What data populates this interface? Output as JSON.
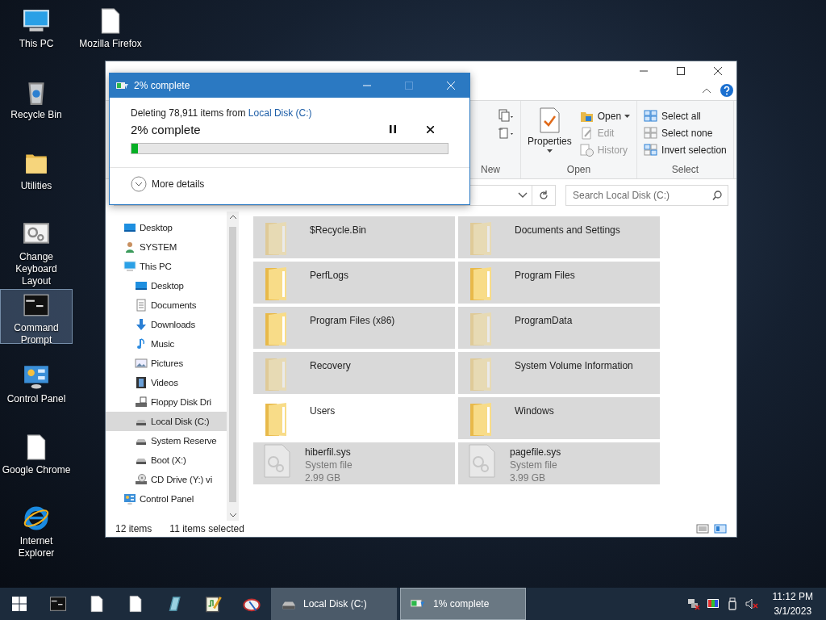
{
  "desktop": {
    "columns": [
      [
        {
          "label": "This PC",
          "kind": "pc",
          "selected": false
        },
        {
          "label": "Recycle Bin",
          "kind": "recycle",
          "selected": false
        },
        {
          "label": "Utilities",
          "kind": "folder",
          "selected": false
        },
        {
          "label": "Change Keyboard Layout",
          "kind": "settings",
          "selected": false
        },
        {
          "label": "Command Prompt",
          "kind": "console",
          "selected": true
        },
        {
          "label": "Control Panel",
          "kind": "control-panel",
          "selected": false
        },
        {
          "label": "Google Chrome",
          "kind": "document",
          "selected": false
        },
        {
          "label": "Internet Explorer",
          "kind": "browser",
          "selected": false
        }
      ],
      [
        {
          "label": "Mozilla Firefox",
          "kind": "document",
          "selected": false
        }
      ]
    ]
  },
  "explorer": {
    "ribbon": {
      "groups": [
        {
          "label": "New",
          "items": [
            {
              "kind": "small-icons"
            }
          ]
        },
        {
          "label": "Open",
          "items": [
            {
              "kind": "big",
              "label": "Properties"
            },
            {
              "kind": "small",
              "label": "Open",
              "caret": true,
              "disabled": false
            },
            {
              "kind": "small",
              "label": "Edit",
              "disabled": true
            },
            {
              "kind": "small",
              "label": "History",
              "disabled": true
            }
          ]
        },
        {
          "label": "Select",
          "items": [
            {
              "kind": "small",
              "label": "Select all",
              "disabled": false
            },
            {
              "kind": "small",
              "label": "Select none",
              "disabled": false
            },
            {
              "kind": "small",
              "label": "Invert selection",
              "disabled": false
            }
          ]
        }
      ]
    },
    "search": {
      "placeholder": "Search Local Disk (C:)"
    },
    "nav": [
      {
        "label": "Desktop",
        "kind": "desktop",
        "selected": false
      },
      {
        "label": "SYSTEM",
        "kind": "user",
        "selected": false
      },
      {
        "label": "This PC",
        "kind": "pc",
        "selected": false,
        "children": [
          {
            "label": "Desktop",
            "kind": "desktop",
            "selected": false
          },
          {
            "label": "Documents",
            "kind": "documents",
            "selected": false
          },
          {
            "label": "Downloads",
            "kind": "downloads",
            "selected": false
          },
          {
            "label": "Music",
            "kind": "music",
            "selected": false
          },
          {
            "label": "Pictures",
            "kind": "pictures",
            "selected": false
          },
          {
            "label": "Videos",
            "kind": "videos",
            "selected": false
          },
          {
            "label": "Floppy Disk Dri",
            "kind": "floppy",
            "selected": false
          },
          {
            "label": "Local Disk (C:)",
            "kind": "drive",
            "selected": true
          },
          {
            "label": "System Reserve",
            "kind": "drive",
            "selected": false
          },
          {
            "label": "Boot (X:)",
            "kind": "drive",
            "selected": false
          },
          {
            "label": "CD Drive (Y:) vi",
            "kind": "cd",
            "selected": false
          }
        ]
      },
      {
        "label": "Control Panel",
        "kind": "control-panel",
        "selected": false
      }
    ],
    "files": [
      {
        "name": "$Recycle.Bin",
        "kind": "folder",
        "hidden": true,
        "selected": true
      },
      {
        "name": "Documents and Settings",
        "kind": "folder",
        "hidden": true,
        "selected": true
      },
      {
        "name": "PerfLogs",
        "kind": "folder",
        "hidden": false,
        "selected": true
      },
      {
        "name": "Program Files",
        "kind": "folder",
        "hidden": false,
        "selected": true
      },
      {
        "name": "Program Files (x86)",
        "kind": "folder",
        "hidden": false,
        "selected": true
      },
      {
        "name": "ProgramData",
        "kind": "folder",
        "hidden": true,
        "selected": true
      },
      {
        "name": "Recovery",
        "kind": "folder",
        "hidden": true,
        "selected": true
      },
      {
        "name": "System Volume Information",
        "kind": "folder",
        "hidden": true,
        "selected": true
      },
      {
        "name": "Users",
        "kind": "folder",
        "hidden": false,
        "selected": false
      },
      {
        "name": "Windows",
        "kind": "folder",
        "hidden": false,
        "selected": true
      },
      {
        "name": "hiberfil.sys",
        "kind": "file",
        "hidden": true,
        "selected": true,
        "type": "System file",
        "size": "2.99 GB"
      },
      {
        "name": "pagefile.sys",
        "kind": "file",
        "hidden": true,
        "selected": true,
        "type": "System file",
        "size": "3.99 GB"
      }
    ],
    "status": {
      "count": "12 items",
      "selection": "11 items selected"
    }
  },
  "dialog": {
    "title": "2% complete",
    "message": "Deleting 78,911 items from ",
    "link": "Local Disk (C:)",
    "heading": "2% complete",
    "level": 0.02,
    "details": "More details",
    "maximize_disabled": true
  },
  "taskbar": {
    "tasks": [
      {
        "label": "Local Disk (C:)",
        "kind": "drive",
        "selected": false
      },
      {
        "label": "1% complete",
        "kind": "progress",
        "selected": true
      }
    ],
    "time": "11:12 PM",
    "date": "3/1/2023"
  }
}
